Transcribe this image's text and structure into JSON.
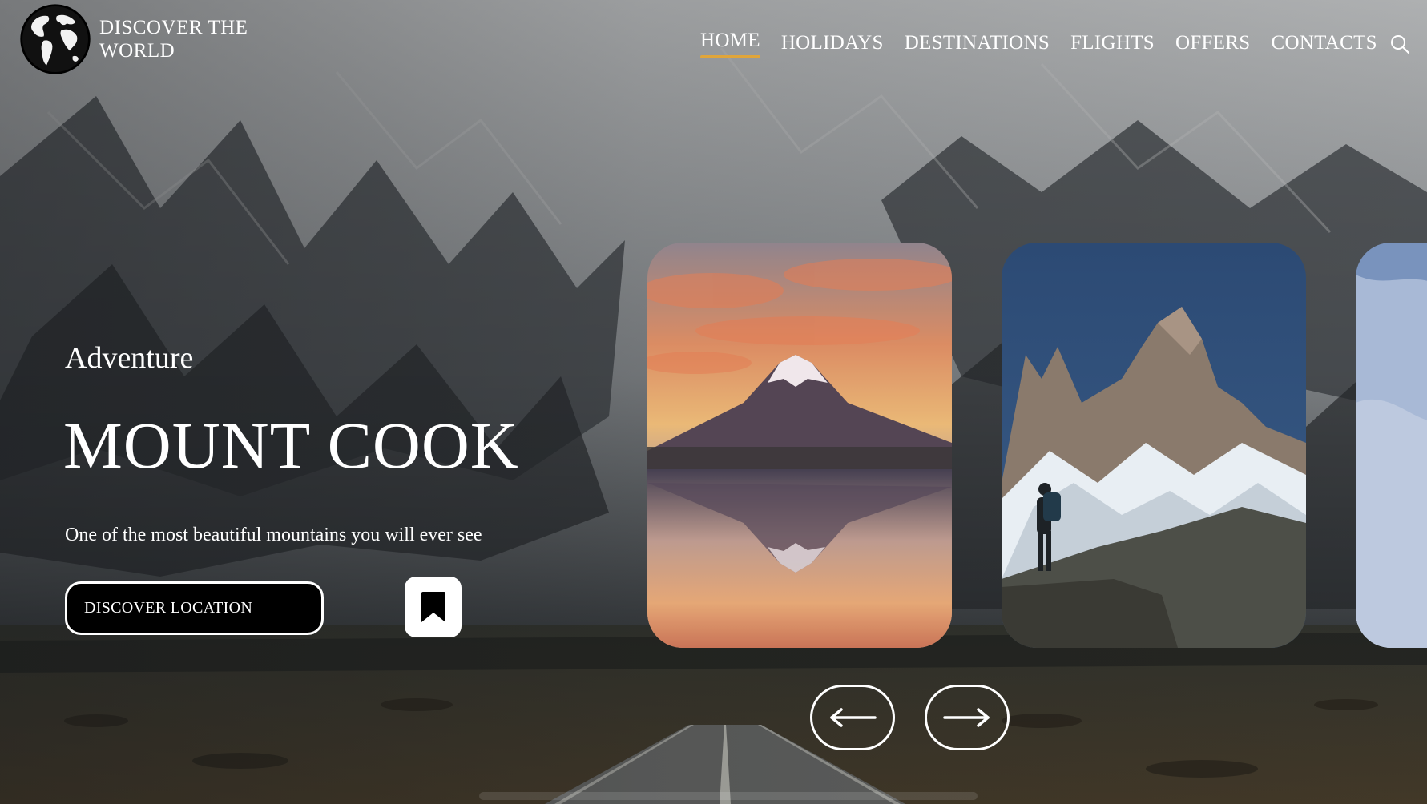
{
  "brand": {
    "line1": "DISCOVER THE",
    "line2": "WORLD",
    "logo_icon": "globe-icon"
  },
  "nav": {
    "items": [
      {
        "label": "HOME",
        "active": true
      },
      {
        "label": "HOLIDAYS",
        "active": false
      },
      {
        "label": "DESTINATIONS",
        "active": false
      },
      {
        "label": "FLIGHTS",
        "active": false
      },
      {
        "label": "OFFERS",
        "active": false
      },
      {
        "label": "CONTACTS",
        "active": false
      }
    ],
    "search_icon": "search-icon",
    "active_underline_color": "#e0a53a"
  },
  "hero": {
    "category": "Adventure",
    "title": "MOUNT COOK",
    "description": "One of the most beautiful mountains you will ever see",
    "cta_label": "DISCOVER LOCATION",
    "bookmark_icon": "bookmark-icon"
  },
  "carousel": {
    "cards": [
      {
        "scene": "volcano-sunset-lake-reflection"
      },
      {
        "scene": "hiker-granite-peaks"
      },
      {
        "scene": "snowy-slope-partial"
      }
    ],
    "prev_icon": "arrow-left-icon",
    "next_icon": "arrow-right-icon"
  }
}
